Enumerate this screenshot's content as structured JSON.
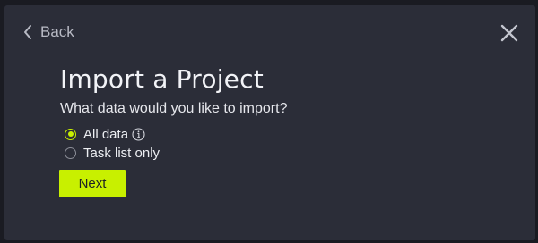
{
  "dialog": {
    "back_label": "Back",
    "title": "Import a Project",
    "question": "What data would you like to import?",
    "options": [
      {
        "label": "All data",
        "selected": true,
        "has_info_icon": true
      },
      {
        "label": "Task list only",
        "selected": false,
        "has_info_icon": false
      }
    ],
    "next_label": "Next"
  },
  "icons": {
    "back": "chevron-left-icon",
    "close": "close-icon",
    "info": "info-icon"
  },
  "colors": {
    "backdrop": "#1a1b22",
    "panel": "#2b2d38",
    "accent": "#c8f000",
    "text": "#f2f3f7",
    "muted": "#b8bac4"
  }
}
